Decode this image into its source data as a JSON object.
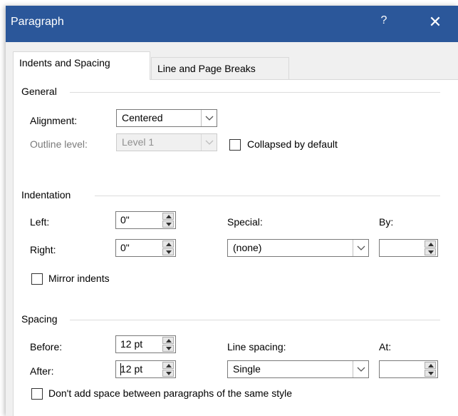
{
  "window": {
    "title": "Paragraph",
    "help_label": "?",
    "close_label": "✕",
    "title_bar_color": "#2b579a"
  },
  "tabs": [
    {
      "label": "Indents and Spacing",
      "active": true
    },
    {
      "label": "Line and Page Breaks",
      "active": false
    }
  ],
  "general": {
    "heading": "General",
    "alignment": {
      "label": "Alignment:",
      "value": "Centered"
    },
    "outline_level": {
      "label": "Outline level:",
      "value": "Level 1",
      "disabled": true
    },
    "collapsed": {
      "label": "Collapsed by default",
      "checked": false
    }
  },
  "indentation": {
    "heading": "Indentation",
    "left": {
      "label": "Left:",
      "value": "0\""
    },
    "right": {
      "label": "Right:",
      "value": "0\""
    },
    "special": {
      "label": "Special:",
      "value": "(none)"
    },
    "by": {
      "label": "By:",
      "value": ""
    },
    "mirror": {
      "label": "Mirror indents",
      "checked": false
    }
  },
  "spacing": {
    "heading": "Spacing",
    "before": {
      "label": "Before:",
      "value": "12 pt"
    },
    "after": {
      "label": "After:",
      "value": "12 pt"
    },
    "line_spacing": {
      "label": "Line spacing:",
      "value": "Single"
    },
    "at": {
      "label": "At:",
      "value": ""
    },
    "dont_add": {
      "label": "Don't add space between paragraphs of the same style",
      "checked": false
    }
  },
  "icons": {
    "dropdown": "chevron-down-icon",
    "spin_up": "triangle-up-icon",
    "spin_down": "triangle-down-icon"
  }
}
